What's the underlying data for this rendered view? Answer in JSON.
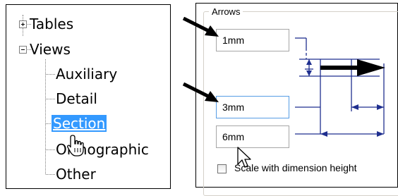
{
  "tree": {
    "items": [
      {
        "label": "Tables",
        "expander": "plus"
      },
      {
        "label": "Views",
        "expander": "minus"
      },
      {
        "label": "Auxiliary"
      },
      {
        "label": "Detail"
      },
      {
        "label": "Section",
        "selected": true
      },
      {
        "label": "Orthographic"
      },
      {
        "label": "Other"
      }
    ],
    "selection_color": "#3399ff"
  },
  "arrows_group": {
    "legend": "Arrows",
    "fields": [
      {
        "value": "1mm"
      },
      {
        "value": "3mm",
        "focused": true
      },
      {
        "value": "6mm"
      }
    ],
    "checkbox": {
      "label": "Scale with dimension height",
      "checked": false
    }
  },
  "cursors": [
    "hand-pointer-cursor",
    "arrow-cursor"
  ],
  "annotations": [
    "callout-arrow",
    "callout-arrow"
  ],
  "colors": {
    "dimension_lines": "#1f2f8f"
  }
}
